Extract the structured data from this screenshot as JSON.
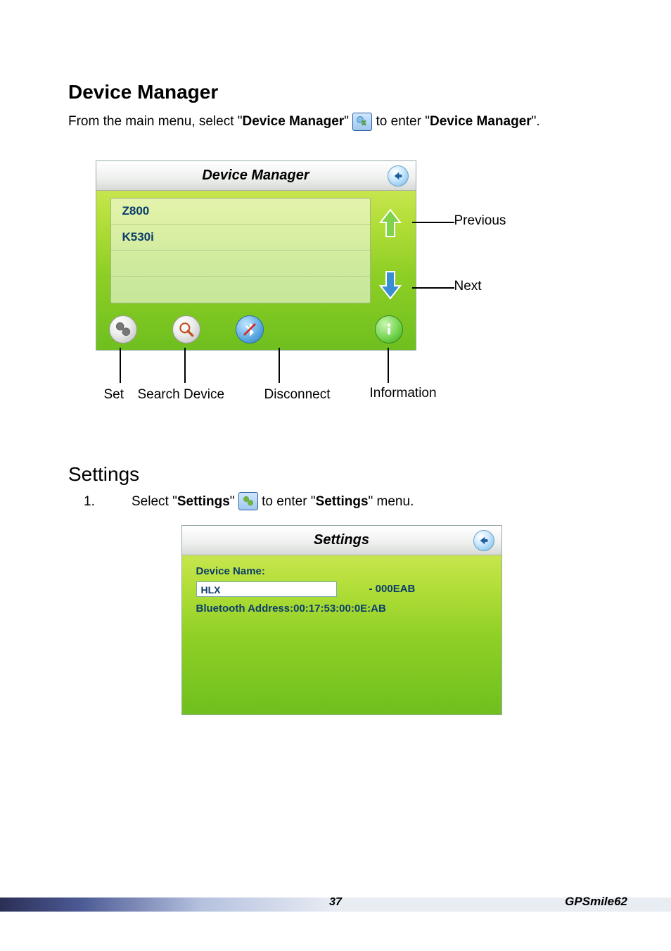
{
  "section1": {
    "title": "Device Manager",
    "intro_part1": "From the main menu, select \"",
    "intro_bold1": "Device Manager",
    "intro_part2": "\" ",
    "intro_part3": " to enter \"",
    "intro_bold2": "Device Manager",
    "intro_part4": "\"."
  },
  "device_ui": {
    "title": "Device Manager",
    "devices": [
      "Z800",
      "K530i"
    ],
    "callouts": {
      "previous": "Previous",
      "next": "Next",
      "set": "Set",
      "search_device": "Search Device",
      "disconnect": "Disconnect",
      "information": "Information"
    }
  },
  "section2": {
    "title": "Settings",
    "step_num": "1.",
    "step_part1": "Select \"",
    "step_bold1": "Settings",
    "step_part2": "\" ",
    "step_part3": " to enter \"",
    "step_bold2": "Settings",
    "step_part4": "\" menu."
  },
  "settings_ui": {
    "title": "Settings",
    "device_name_label": "Device Name:",
    "device_name_value": "HLX",
    "device_name_suffix": "- 000EAB",
    "bt_address": "Bluetooth Address:00:17:53:00:0E:AB"
  },
  "footer": {
    "page": "37",
    "brand": "GPSmile62"
  }
}
